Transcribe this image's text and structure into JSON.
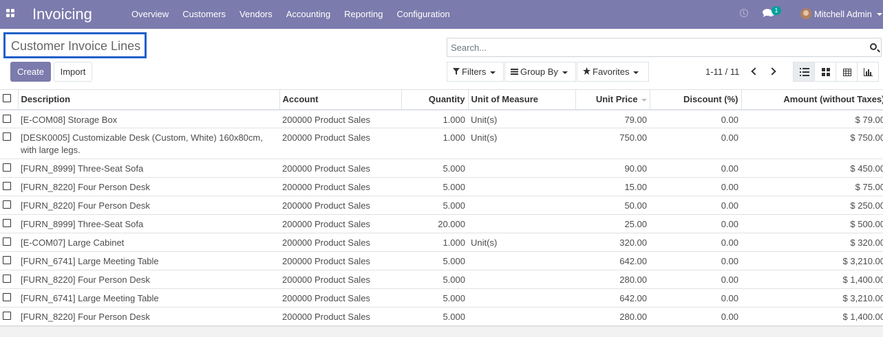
{
  "navbar": {
    "app_name": "Invoicing",
    "menu": [
      "Overview",
      "Customers",
      "Vendors",
      "Accounting",
      "Reporting",
      "Configuration"
    ],
    "message_count": "1",
    "user_name": "Mitchell Admin"
  },
  "page": {
    "title": "Customer Invoice Lines",
    "create_label": "Create",
    "import_label": "Import"
  },
  "search": {
    "placeholder": "Search..."
  },
  "filters": {
    "filters_label": "Filters",
    "group_by_label": "Group By",
    "favorites_label": "Favorites"
  },
  "pager": {
    "value": "1-11 / 11"
  },
  "colors": {
    "brand": "#7c7bad",
    "title_outline": "#1c5fc9",
    "badge": "#00a09d"
  },
  "table": {
    "columns": [
      "Description",
      "Account",
      "Quantity",
      "Unit of Measure",
      "Unit Price",
      "Discount (%)",
      "Amount (without Taxes)"
    ],
    "rows": [
      [
        "[E-COM08] Storage Box",
        "200000 Product Sales",
        "1.000",
        "Unit(s)",
        "79.00",
        "0.00",
        "$ 79.00"
      ],
      [
        "[DESK0005] Customizable Desk (Custom, White) 160x80cm, with large legs.",
        "200000 Product Sales",
        "1.000",
        "Unit(s)",
        "750.00",
        "0.00",
        "$ 750.00"
      ],
      [
        "[FURN_8999] Three-Seat Sofa",
        "200000 Product Sales",
        "5.000",
        "",
        "90.00",
        "0.00",
        "$ 450.00"
      ],
      [
        "[FURN_8220] Four Person Desk",
        "200000 Product Sales",
        "5.000",
        "",
        "15.00",
        "0.00",
        "$ 75.00"
      ],
      [
        "[FURN_8220] Four Person Desk",
        "200000 Product Sales",
        "5.000",
        "",
        "50.00",
        "0.00",
        "$ 250.00"
      ],
      [
        "[FURN_8999] Three-Seat Sofa",
        "200000 Product Sales",
        "20.000",
        "",
        "25.00",
        "0.00",
        "$ 500.00"
      ],
      [
        "[E-COM07] Large Cabinet",
        "200000 Product Sales",
        "1.000",
        "Unit(s)",
        "320.00",
        "0.00",
        "$ 320.00"
      ],
      [
        "[FURN_6741] Large Meeting Table",
        "200000 Product Sales",
        "5.000",
        "",
        "642.00",
        "0.00",
        "$ 3,210.00"
      ],
      [
        "[FURN_8220] Four Person Desk",
        "200000 Product Sales",
        "5.000",
        "",
        "280.00",
        "0.00",
        "$ 1,400.00"
      ],
      [
        "[FURN_6741] Large Meeting Table",
        "200000 Product Sales",
        "5.000",
        "",
        "642.00",
        "0.00",
        "$ 3,210.00"
      ],
      [
        "[FURN_8220] Four Person Desk",
        "200000 Product Sales",
        "5.000",
        "",
        "280.00",
        "0.00",
        "$ 1,400.00"
      ]
    ]
  }
}
